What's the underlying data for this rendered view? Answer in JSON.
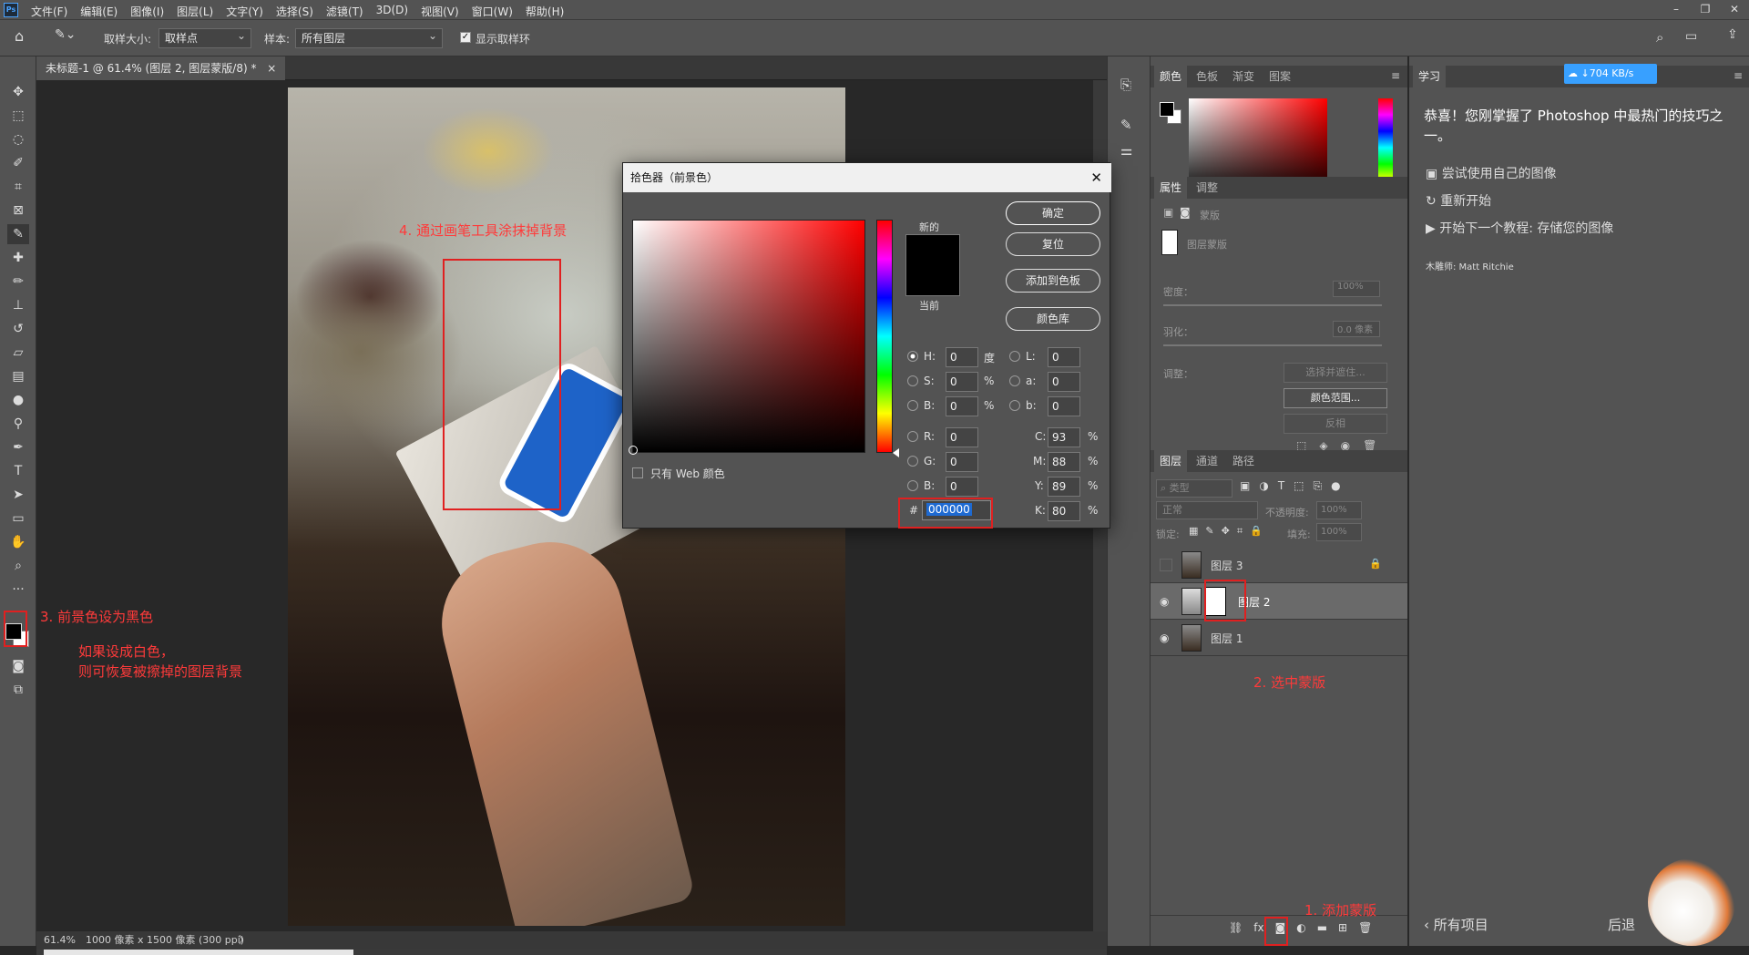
{
  "menubar": {
    "logo": "Ps",
    "items": [
      "文件(F)",
      "编辑(E)",
      "图像(I)",
      "图层(L)",
      "文字(Y)",
      "选择(S)",
      "滤镜(T)",
      "3D(D)",
      "视图(V)",
      "窗口(W)",
      "帮助(H)"
    ],
    "minimize": "–",
    "restore": "❐",
    "close": "✕"
  },
  "options": {
    "sample_size_label": "取样大小:",
    "sample_size_value": "取样点",
    "sample_label": "样本:",
    "sample_value": "所有图层",
    "show_ring_label": "显示取样环"
  },
  "document_tab": {
    "title": "未标题-1 @ 61.4% (图层 2, 图层蒙版/8) *",
    "close": "×"
  },
  "status": {
    "zoom": "61.4%",
    "size": "1000 像素 x 1500 像素 (300 ppi)",
    "arrow": "〉"
  },
  "annotations": {
    "step4": "4. 通过画笔工具涂抹掉背景",
    "step3": "3. 前景色设为黑色",
    "step3_note_1": "如果设成白色，",
    "step3_note_2": "则可恢复被擦掉的图层背景",
    "step2": "2. 选中蒙版",
    "step1": "1. 添加蒙版"
  },
  "color_picker": {
    "title": "拾色器（前景色）",
    "close": "✕",
    "ok": "确定",
    "reset": "复位",
    "add_swatch": "添加到色板",
    "color_library": "颜色库",
    "new_label": "新的",
    "current_label": "当前",
    "web_only": "只有 Web 颜色",
    "hsb": [
      {
        "label": "H:",
        "value": "0",
        "unit": "度"
      },
      {
        "label": "S:",
        "value": "0",
        "unit": "%"
      },
      {
        "label": "B:",
        "value": "0",
        "unit": "%"
      }
    ],
    "rgb": [
      {
        "label": "R:",
        "value": "0"
      },
      {
        "label": "G:",
        "value": "0"
      },
      {
        "label": "B:",
        "value": "0"
      }
    ],
    "lab": [
      {
        "label": "L:",
        "value": "0"
      },
      {
        "label": "a:",
        "value": "0"
      },
      {
        "label": "b:",
        "value": "0"
      }
    ],
    "cmyk": [
      {
        "label": "C:",
        "value": "93",
        "unit": "%"
      },
      {
        "label": "M:",
        "value": "88",
        "unit": "%"
      },
      {
        "label": "Y:",
        "value": "89",
        "unit": "%"
      },
      {
        "label": "K:",
        "value": "80",
        "unit": "%"
      }
    ],
    "hex_label": "#",
    "hex_value": "000000",
    "new_color": "#000000",
    "current_color": "#000000"
  },
  "color_panel": {
    "tabs": [
      "颜色",
      "色板",
      "渐变",
      "图案"
    ],
    "menu": "≡"
  },
  "properties_panel": {
    "tabs": [
      "属性",
      "调整"
    ],
    "mask_label": "蒙版",
    "layer_mask_label": "图层蒙版",
    "density_label": "密度：",
    "density_value": "100%",
    "feather_label": "羽化：",
    "feather_value": "0.0 像素",
    "adjust_label": "调整：",
    "select_mask_btn": "选择并遮住...",
    "color_range_btn": "颜色范围...",
    "invert_btn": "反相"
  },
  "layers_panel": {
    "tabs": [
      "图层",
      "通道",
      "路径"
    ],
    "filter_placeholder": "类型",
    "blend_mode": "正常",
    "opacity_label": "不透明度:",
    "opacity_value": "100%",
    "lock_label": "锁定:",
    "fill_label": "填充:",
    "fill_value": "100%",
    "layers": [
      {
        "name": "图层 3",
        "visible": false,
        "locked": true
      },
      {
        "name": "图层 2",
        "visible": true,
        "selected": true
      },
      {
        "name": "图层 1",
        "visible": true
      }
    ],
    "bottom_icons": [
      "link-icon",
      "fx-icon",
      "mask-icon",
      "adjustment-icon",
      "group-icon",
      "new-layer-icon",
      "trash-icon"
    ],
    "fx": "fx"
  },
  "learn_panel": {
    "tab": "学习",
    "speed": "704 KB/s",
    "heading": "恭喜！您刚掌握了 Photoshop 中最热门的技巧之一。",
    "links": [
      "尝试使用自己的图像",
      "重新开始",
      "开始下一个教程: 存储您的图像"
    ],
    "credit": "木雕师:  Matt Ritchie",
    "back": "所有项目",
    "next": "后退"
  }
}
